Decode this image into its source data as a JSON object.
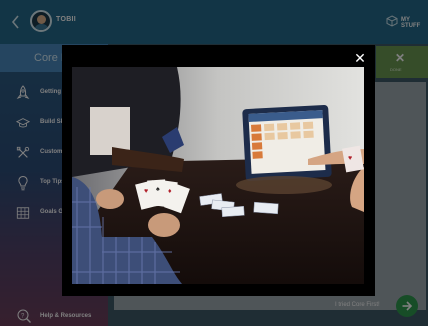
{
  "header": {
    "username": "TOBII",
    "my_stuff_label": "MY STUFF",
    "back_icon": "chevron-left-icon",
    "my_stuff_icon": "box-icon"
  },
  "sidebar": {
    "title": "Core F",
    "items": [
      {
        "label": "Getting",
        "icon": "rocket-icon"
      },
      {
        "label": "Build Sk",
        "icon": "graduation-cap-icon"
      },
      {
        "label": "Custom",
        "icon": "tools-icon"
      },
      {
        "label": "Top Tips",
        "icon": "lightbulb-icon"
      },
      {
        "label": "Goals G",
        "icon": "grid-icon"
      }
    ],
    "help": {
      "label": "Help & Resources",
      "icon": "help-search-icon"
    }
  },
  "main": {
    "close_label": "DONE",
    "tried_label": "I tried Core First!"
  },
  "modal": {
    "close_symbol": "✕"
  },
  "colors": {
    "topbar": "#256b8c",
    "sidebar_title": "#4a8bc0",
    "accent_green": "#6c9b52",
    "go_button": "#2f9a4f"
  }
}
